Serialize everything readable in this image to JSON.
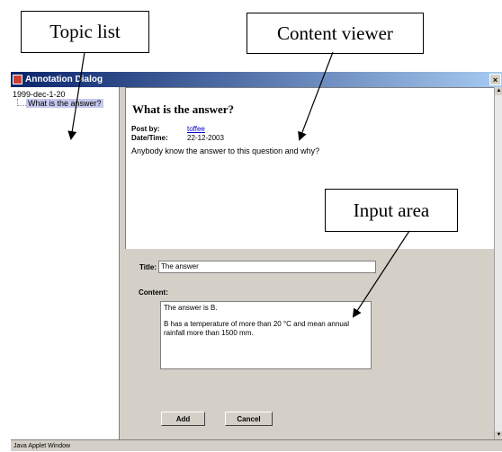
{
  "callouts": {
    "topic_list": "Topic list",
    "content_viewer": "Content viewer",
    "input_area": "Input area"
  },
  "window": {
    "title": "Annotation Dialog",
    "close_glyph": "×",
    "status_bar": "Java Applet Window"
  },
  "tree": {
    "root": "1999-dec-1-20",
    "items": [
      {
        "label": "What is the answer?",
        "selected": true
      }
    ]
  },
  "post": {
    "title": "What is the answer?",
    "post_by_label": "Post by:",
    "author": "toffee",
    "datetime_label": "Date/Time:",
    "datetime": "22-12-2003",
    "body": "Anybody know the answer to this question and why?"
  },
  "form": {
    "title_label": "Title:",
    "title_value": "The answer",
    "content_label": "Content:",
    "content_lines": [
      "The answer is B.",
      "B has a temperature of more than 20 °C and mean annual rainfall more than 1500 mm."
    ],
    "add_button": "Add",
    "cancel_button": "Cancel"
  },
  "scrollbar": {
    "up_glyph": "▲",
    "down_glyph": "▼"
  }
}
